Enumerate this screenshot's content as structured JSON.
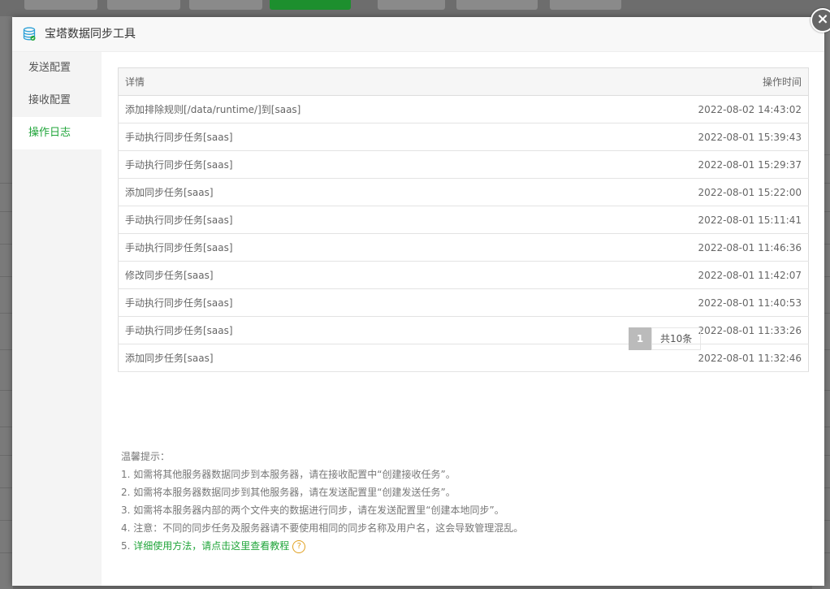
{
  "dialog": {
    "title": "宝塔数据同步工具",
    "close_label": "×"
  },
  "sidebar": {
    "items": [
      {
        "label": "发送配置"
      },
      {
        "label": "接收配置"
      },
      {
        "label": "操作日志",
        "active": true
      }
    ]
  },
  "table": {
    "headers": {
      "detail": "详情",
      "time": "操作时间"
    },
    "rows": [
      {
        "detail": "添加排除规则[/data/runtime/]到[saas]",
        "time": "2022-08-02 14:43:02"
      },
      {
        "detail": "手动执行同步任务[saas]",
        "time": "2022-08-01 15:39:43"
      },
      {
        "detail": "手动执行同步任务[saas]",
        "time": "2022-08-01 15:29:37"
      },
      {
        "detail": "添加同步任务[saas]",
        "time": "2022-08-01 15:22:00"
      },
      {
        "detail": "手动执行同步任务[saas]",
        "time": "2022-08-01 15:11:41"
      },
      {
        "detail": "手动执行同步任务[saas]",
        "time": "2022-08-01 11:46:36"
      },
      {
        "detail": "修改同步任务[saas]",
        "time": "2022-08-01 11:42:07"
      },
      {
        "detail": "手动执行同步任务[saas]",
        "time": "2022-08-01 11:40:53"
      },
      {
        "detail": "手动执行同步任务[saas]",
        "time": "2022-08-01 11:33:26"
      },
      {
        "detail": "添加同步任务[saas]",
        "time": "2022-08-01 11:32:46"
      }
    ]
  },
  "pagination": {
    "current": "1",
    "total": "共10条"
  },
  "tips": {
    "heading": "温馨提示：",
    "lines": [
      "1. 如需将其他服务器数据同步到本服务器，请在接收配置中“创建接收任务”。",
      "2. 如需将本服务器数据同步到其他服务器，请在发送配置里“创建发送任务”。",
      "3. 如需将本服务器内部的两个文件夹的数据进行同步，请在发送配置里“创建本地同步”。",
      "4. 注意：不同的同步任务及服务器请不要使用相同的同步名称及用户名，这会导致管理混乱。"
    ],
    "link_prefix": "5. ",
    "link_text": "详细使用方法，请点击这里查看教程",
    "help_symbol": "?"
  },
  "colors": {
    "accent": "#20a53a",
    "overlay": "#6d6d6d",
    "help": "#e0a020"
  },
  "icons": {
    "title_icon": "database-icon",
    "close": "close-icon",
    "help": "question-circle-icon"
  }
}
